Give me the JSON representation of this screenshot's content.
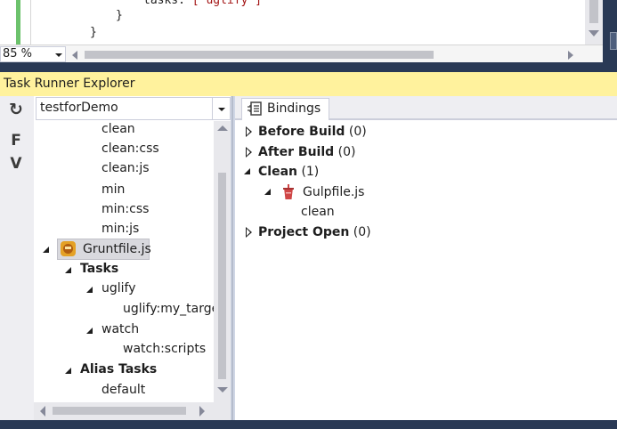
{
  "editor": {
    "code_lines": [
      {
        "prefix": "tasks: ",
        "string": "[ uglify ]"
      },
      {
        "prefix": "}",
        "string": ""
      },
      {
        "prefix": "}",
        "string": ""
      }
    ],
    "zoom_label": "85 %"
  },
  "panel": {
    "title": "Task Runner Explorer"
  },
  "toolbar": {
    "refresh_icon": "refresh-icon",
    "f_label": "F",
    "v_label": "V"
  },
  "left": {
    "project_selected": "testforDemo",
    "tree": {
      "gulp_tasks": [
        "clean",
        "clean:css",
        "clean:js",
        "min",
        "min:css",
        "min:js"
      ],
      "gruntfile": "Gruntfile.js",
      "tasks_label": "Tasks",
      "uglify_label": "uglify",
      "uglify_target": "uglify:my_target",
      "watch_label": "watch",
      "watch_target": "watch:scripts",
      "alias_label": "Alias Tasks",
      "alias_default": "default"
    }
  },
  "right": {
    "tab_label": "Bindings",
    "bindings": [
      {
        "name": "Before Build",
        "count": "(0)",
        "expanded": false
      },
      {
        "name": "After Build",
        "count": "(0)",
        "expanded": false
      },
      {
        "name": "Clean",
        "count": "(1)",
        "expanded": true
      },
      {
        "name": "Project Open",
        "count": "(0)",
        "expanded": false
      }
    ],
    "clean_file": "Gulpfile.js",
    "clean_task": "clean"
  },
  "colors": {
    "title_bar": "#fff29d",
    "frame": "#293955",
    "gutter_changed": "#6cc26c",
    "gulp_red": "#cf4646"
  }
}
